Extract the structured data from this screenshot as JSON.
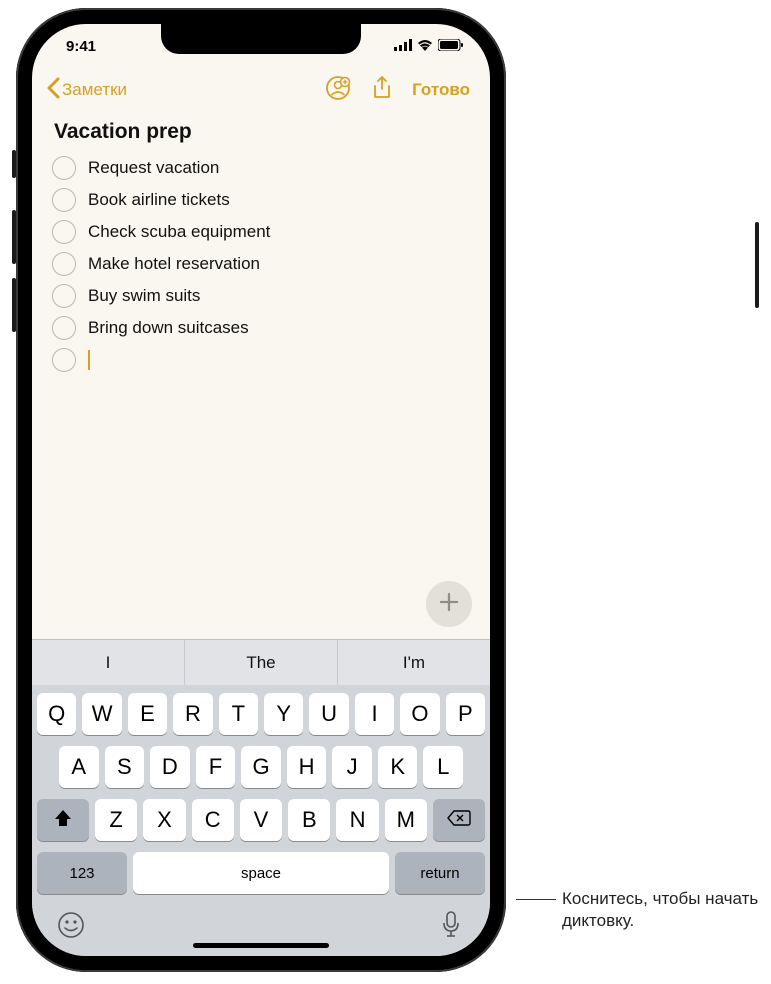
{
  "status": {
    "time": "9:41"
  },
  "nav": {
    "back_label": "Заметки",
    "done_label": "Готово"
  },
  "note": {
    "title": "Vacation prep",
    "items": [
      "Request vacation",
      "Book airline tickets",
      "Check scuba equipment",
      "Make hotel reservation",
      "Buy swim suits",
      "Bring down suitcases"
    ]
  },
  "keyboard": {
    "suggestions": [
      "I",
      "The",
      "I'm"
    ],
    "row1": [
      "Q",
      "W",
      "E",
      "R",
      "T",
      "Y",
      "U",
      "I",
      "O",
      "P"
    ],
    "row2": [
      "A",
      "S",
      "D",
      "F",
      "G",
      "H",
      "J",
      "K",
      "L"
    ],
    "row3": [
      "Z",
      "X",
      "C",
      "V",
      "B",
      "N",
      "M"
    ],
    "numkey": "123",
    "space": "space",
    "return": "return"
  },
  "callout": {
    "text": "Коснитесь, чтобы начать диктовку."
  }
}
